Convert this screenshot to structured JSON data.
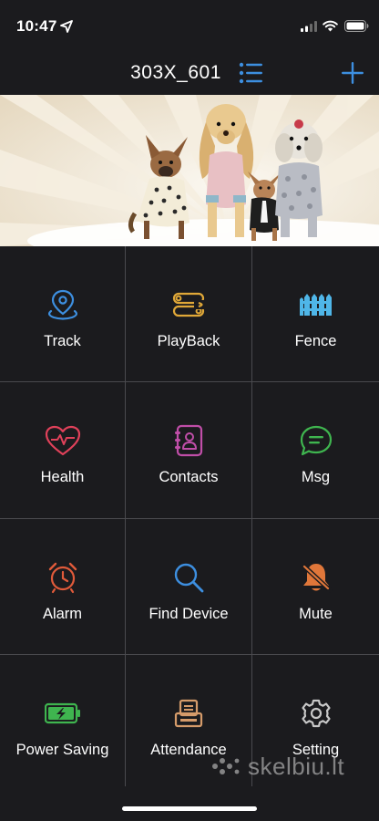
{
  "status_bar": {
    "time": "10:47",
    "location_icon": "location-arrow-icon",
    "signal_icon": "cellular-signal-icon",
    "wifi_icon": "wifi-icon",
    "battery_icon": "battery-icon"
  },
  "nav": {
    "title": "303X_601",
    "list_icon": "list-icon",
    "add_icon": "plus-icon",
    "accent": "#3d8fe0"
  },
  "banner": {
    "description_icon": "dogs-banner-image"
  },
  "menu": [
    {
      "label": "Track",
      "icon": "location-pin-icon",
      "color": "#3d8fe0"
    },
    {
      "label": "PlayBack",
      "icon": "route-icon",
      "color": "#e0a838"
    },
    {
      "label": "Fence",
      "icon": "fence-icon",
      "color": "#4fb6e8"
    },
    {
      "label": "Health",
      "icon": "heart-pulse-icon",
      "color": "#e0415a"
    },
    {
      "label": "Contacts",
      "icon": "contacts-book-icon",
      "color": "#c04ea8"
    },
    {
      "label": "Msg",
      "icon": "chat-bubble-icon",
      "color": "#3fb54f"
    },
    {
      "label": "Alarm",
      "icon": "alarm-clock-icon",
      "color": "#e05a3a"
    },
    {
      "label": "Find Device",
      "icon": "magnifier-icon",
      "color": "#3d8fe0"
    },
    {
      "label": "Mute",
      "icon": "bell-mute-icon",
      "color": "#e0773a"
    },
    {
      "label": "Power Saving",
      "icon": "battery-charging-icon",
      "color": "#3fb54f"
    },
    {
      "label": "Attendance",
      "icon": "attendance-machine-icon",
      "color": "#d59b6a"
    },
    {
      "label": "Setting",
      "icon": "gear-icon",
      "color": "#c8c8c8"
    }
  ],
  "watermark": {
    "text": "skelbiu.lt"
  }
}
